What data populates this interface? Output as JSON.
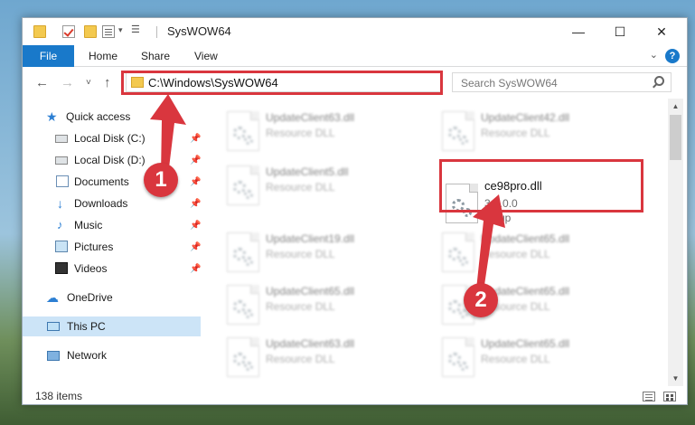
{
  "window": {
    "title": "SysWOW64",
    "minimize": "—",
    "maximize": "☐",
    "close": "✕"
  },
  "ribbon": {
    "file_tab": "File",
    "tabs": [
      "Home",
      "Share",
      "View"
    ],
    "help": "?",
    "expand": "⌵"
  },
  "nav": {
    "back": "←",
    "forward": "→",
    "recent": "˅",
    "up": "↑",
    "address": "C:\\Windows\\SysWOW64",
    "address_dropdown": "˅",
    "refresh": "↻",
    "search_placeholder": "Search SysWOW64"
  },
  "sidebar": {
    "items": [
      {
        "label": "Quick access",
        "icon": "star-icon",
        "pinned": false
      },
      {
        "label": "Local Disk (C:)",
        "icon": "disk-icon",
        "pinned": true
      },
      {
        "label": "Local Disk (D:)",
        "icon": "disk-icon",
        "pinned": true
      },
      {
        "label": "Documents",
        "icon": "documents-icon",
        "pinned": true
      },
      {
        "label": "Downloads",
        "icon": "download-icon",
        "pinned": true
      },
      {
        "label": "Music",
        "icon": "music-icon",
        "pinned": true
      },
      {
        "label": "Pictures",
        "icon": "pictures-icon",
        "pinned": true
      },
      {
        "label": "Videos",
        "icon": "videos-icon",
        "pinned": true
      },
      {
        "label": "OneDrive",
        "icon": "cloud-icon",
        "pinned": false
      },
      {
        "label": "This PC",
        "icon": "computer-icon",
        "pinned": false,
        "selected": true
      },
      {
        "label": "Network",
        "icon": "network-icon",
        "pinned": false
      }
    ],
    "pin_glyph": "⬤"
  },
  "files": [
    {
      "name": "UpdateClient63.dll",
      "line2": "Resource DLL",
      "line3": "",
      "blurred": true
    },
    {
      "name": "UpdateClient42.dll",
      "line2": "Resource DLL",
      "line3": "",
      "blurred": true
    },
    {
      "name": "UpdateClient5.dll",
      "line2": "Resource DLL",
      "line3": "",
      "blurred": true
    },
    {
      "name": "ce98pro.dll",
      "line2": "3.0.0.0",
      "line3": "setup",
      "blurred": false
    },
    {
      "name": "UpdateClient19.dll",
      "line2": "Resource DLL",
      "line3": "",
      "blurred": true
    },
    {
      "name": "UpdateClient65.dll",
      "line2": "Resource DLL",
      "line3": "",
      "blurred": true
    },
    {
      "name": "UpdateClient65.dll",
      "line2": "Resource DLL",
      "line3": "",
      "blurred": true
    },
    {
      "name": "UpdateClient65.dll",
      "line2": "Resource DLL",
      "line3": "",
      "blurred": true
    },
    {
      "name": "UpdateClient63.dll",
      "line2": "Resource DLL",
      "line3": "",
      "blurred": true
    },
    {
      "name": "UpdateClient65.dll",
      "line2": "Resource DLL",
      "line3": "",
      "blurred": true
    }
  ],
  "status": {
    "item_count": "138 items"
  },
  "annotations": {
    "step1": "1",
    "step2": "2",
    "color": "#d9363e"
  },
  "colors": {
    "accent": "#1979ca",
    "selected": "#cce4f7",
    "highlight": "#d9363e"
  }
}
